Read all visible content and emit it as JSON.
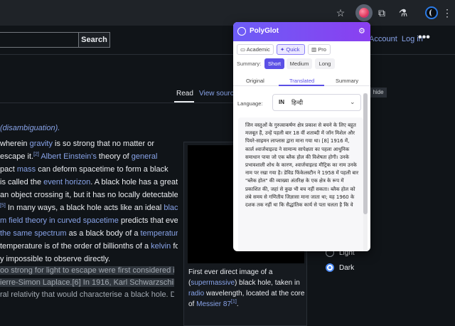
{
  "browser": {
    "toolbar_icons": [
      "star-icon",
      "polyglot-extension-icon",
      "puzzle-extensions-icon",
      "flask-icon",
      "profile-icon",
      "more-icon"
    ]
  },
  "wiki": {
    "search_button": "Search",
    "account": "Account",
    "login": "Log in",
    "more": "•••",
    "tab_read": "Read",
    "tab_view_source": "View source",
    "hide": "hide",
    "disambiguation": "(disambiguation).",
    "paragraph_lines": [
      [
        "wherein ",
        "gravity",
        " is so strong that no matter or"
      ],
      [
        "escape it.",
        "[2]",
        " ",
        "Albert Einstein's",
        " theory of ",
        "general"
      ],
      [
        "pact ",
        "mass",
        " can deform spacetime to form a black"
      ],
      [
        " is called the ",
        "event horizon",
        ". A black hole has a great"
      ],
      [
        " an object crossing it, but it has no locally detectable"
      ],
      [
        "[5]",
        " In many ways, a black hole acts like an ideal ",
        "black"
      ],
      [
        "m field theory in curved spacetime",
        " predicts that event"
      ],
      [
        "the same spectrum",
        " as a black body of a ",
        "temperature"
      ],
      [
        " temperature is of the order of billionths of a ",
        "kelvin",
        " for"
      ],
      [
        "y impossible to observe directly."
      ]
    ],
    "paragraph2_lines": [
      "oo strong for light to escape were first considered in",
      "ierre-Simon Laplace.[6] In 1916, Karl Schwarzschild",
      "ral relativity that would characterise a black hole. Due"
    ],
    "caption": {
      "prefix": "First ever direct image of a (",
      "link1": "supermassive",
      "mid1": ") black hole, taken in ",
      "link2": "radio",
      "mid2": " wavelength, located at the core of ",
      "link3": "Messier 87",
      "ref": "[1]",
      "suffix": "."
    },
    "theme": {
      "light": "Light",
      "dark": "Dark",
      "selected": "Dark"
    }
  },
  "popup": {
    "title": "PolyGlot",
    "modes": [
      {
        "label": "Academic",
        "icon": "book-icon",
        "selected": false
      },
      {
        "label": "Quick",
        "icon": "sparkle-icon",
        "selected": true
      },
      {
        "label": "Pro",
        "icon": "columns-icon",
        "selected": false
      }
    ],
    "summary_label": "Summary:",
    "lengths": [
      {
        "label": "Short",
        "selected": true
      },
      {
        "label": "Medium",
        "selected": false
      },
      {
        "label": "Long",
        "selected": false
      }
    ],
    "tabs": [
      "Original",
      "Translated",
      "Summary"
    ],
    "active_tab": "Translated",
    "language_label": "Language:",
    "language_code": "IN",
    "language_name": "हिन्दी",
    "translated_text": "जिन वस्तुओं के गुरुत्वाकर्षण क्षेत्र प्रकाश से बचने के लिए बहुत मजबूत हैं, उन्हें पहली बार 18 वीं शताब्दी में जॉन मिशेल और पियरे-साइमन लाप्लास द्वारा माना गया था। [8] 1916 में, कार्ल श्वार्जचाइल्ड ने सामान्य सापेक्षता का पहला आधुनिक समाधान पाया जो एक ब्लैक होल की विशेषता होगी। उनके प्रभावशाली शोध के कारण, श्वार्जचाइल्ड मीट्रिक का नाम उनके नाम पर रखा गया है। डेविड फिंकेलस्टीन ने 1958 में पहली बार \"ब्लैक होल\" की व्याख्या अंतरिक्ष के एक क्षेत्र के रूप में प्रकाशित की, जहां से कुछ भी बच नहीं सकता। ब्लैक होल को लंबे समय से गणितीय जिज्ञासा माना जाता था; यह 1960 के दशक तक नहीं था कि सैद्धांतिक कार्य से पता चलता है कि वे"
  }
}
